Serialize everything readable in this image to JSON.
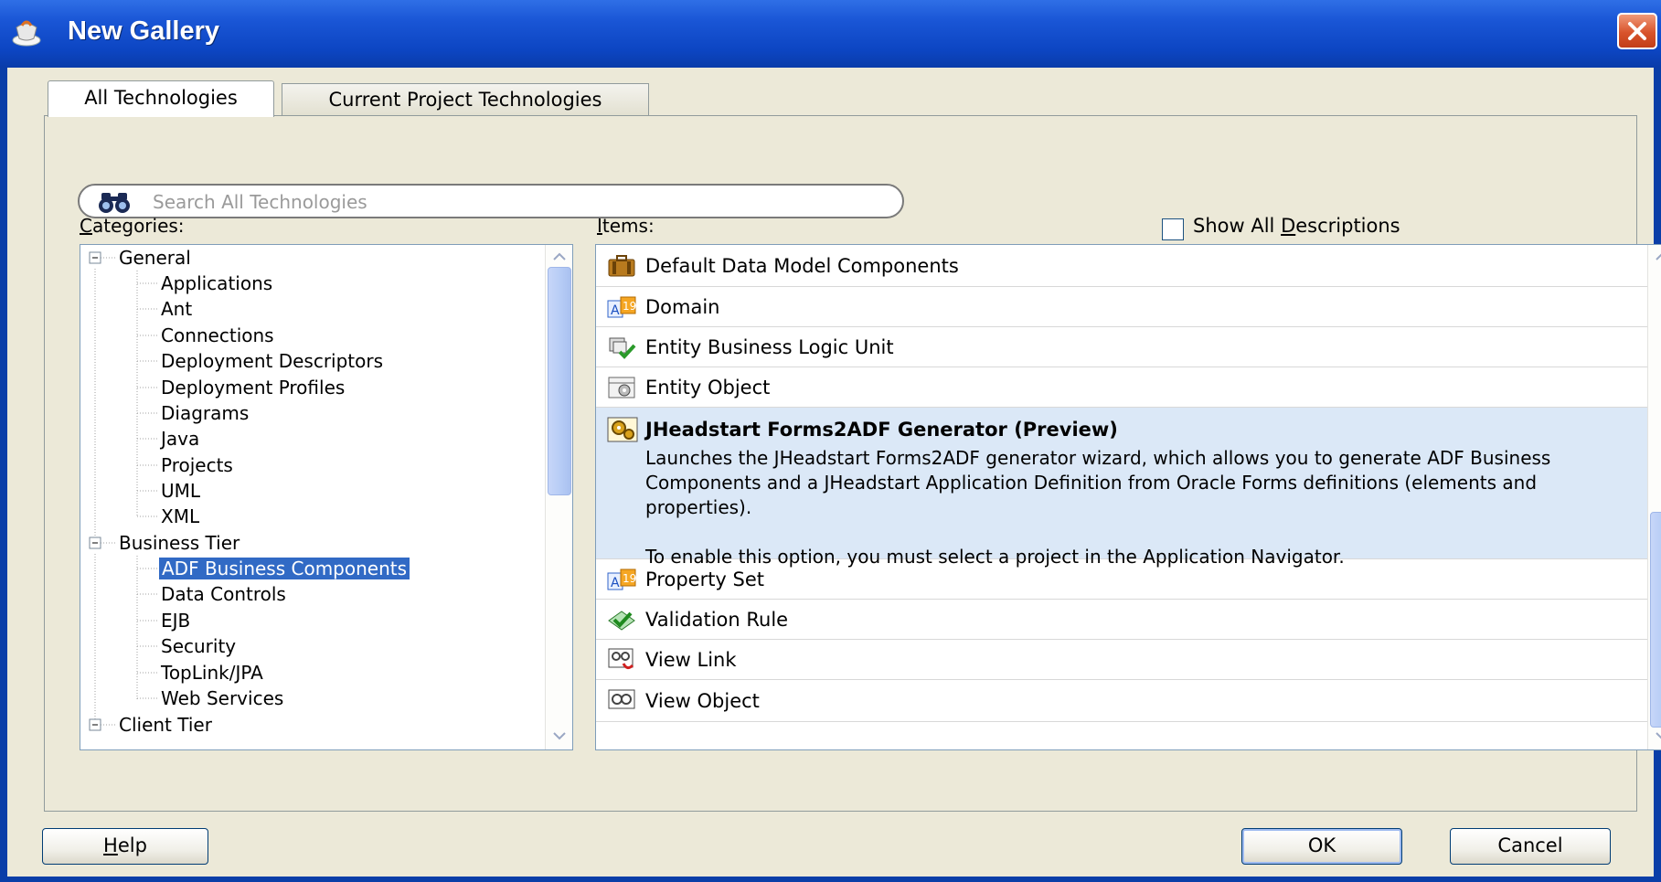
{
  "window": {
    "title": "New Gallery"
  },
  "tabs": [
    {
      "label": "All Technologies",
      "active": true
    },
    {
      "label": "Current Project Technologies",
      "active": false
    }
  ],
  "search": {
    "placeholder": "Search All Technologies",
    "value": ""
  },
  "categories": {
    "label_mnemonic": "C",
    "label_rest": "ategories:",
    "tree": [
      {
        "label": "General",
        "level": 0,
        "expanded": true
      },
      {
        "label": "Applications",
        "level": 1
      },
      {
        "label": "Ant",
        "level": 1
      },
      {
        "label": "Connections",
        "level": 1
      },
      {
        "label": "Deployment Descriptors",
        "level": 1
      },
      {
        "label": "Deployment Profiles",
        "level": 1
      },
      {
        "label": "Diagrams",
        "level": 1
      },
      {
        "label": "Java",
        "level": 1
      },
      {
        "label": "Projects",
        "level": 1
      },
      {
        "label": "UML",
        "level": 1
      },
      {
        "label": "XML",
        "level": 1
      },
      {
        "label": "Business Tier",
        "level": 0,
        "expanded": true
      },
      {
        "label": "ADF Business Components",
        "level": 1,
        "selected": true
      },
      {
        "label": "Data Controls",
        "level": 1
      },
      {
        "label": "EJB",
        "level": 1
      },
      {
        "label": "Security",
        "level": 1
      },
      {
        "label": "TopLink/JPA",
        "level": 1
      },
      {
        "label": "Web Services",
        "level": 1
      },
      {
        "label": "Client Tier",
        "level": 0,
        "expanded": true
      }
    ]
  },
  "items": {
    "label_mnemonic": "I",
    "label_rest": "tems:",
    "show_all_descriptions": {
      "before": "Show All ",
      "mnemonic": "D",
      "after": "escriptions",
      "checked": false
    },
    "list": [
      {
        "name": "Default Data Model Components",
        "icon": "briefcase-icon"
      },
      {
        "name": "Domain",
        "icon": "domain-icon"
      },
      {
        "name": "Entity Business Logic Unit",
        "icon": "logic-unit-icon"
      },
      {
        "name": "Entity Object",
        "icon": "entity-object-icon"
      },
      {
        "name": "JHeadstart Forms2ADF Generator (Preview)",
        "icon": "generator-icon",
        "selected": true,
        "description_1": "Launches the JHeadstart Forms2ADF generator wizard, which allows you to generate ADF Business Components and a JHeadstart Application Definition from Oracle Forms definitions (elements and properties).",
        "description_2": "To enable this option, you must select a project in the Application Navigator."
      },
      {
        "name": "Property Set",
        "icon": "property-set-icon"
      },
      {
        "name": "Validation Rule",
        "icon": "validation-rule-icon"
      },
      {
        "name": "View Link",
        "icon": "view-link-icon"
      },
      {
        "name": "View Object",
        "icon": "view-object-icon"
      }
    ]
  },
  "buttons": {
    "help": {
      "mnemonic": "H",
      "rest": "elp"
    },
    "ok": "OK",
    "cancel": "Cancel"
  },
  "colors": {
    "selection": "#316ac5",
    "item_selected_bg": "#dbe8f7",
    "title_bar": "#0c45c2",
    "dialog_bg": "#ece9d8"
  }
}
